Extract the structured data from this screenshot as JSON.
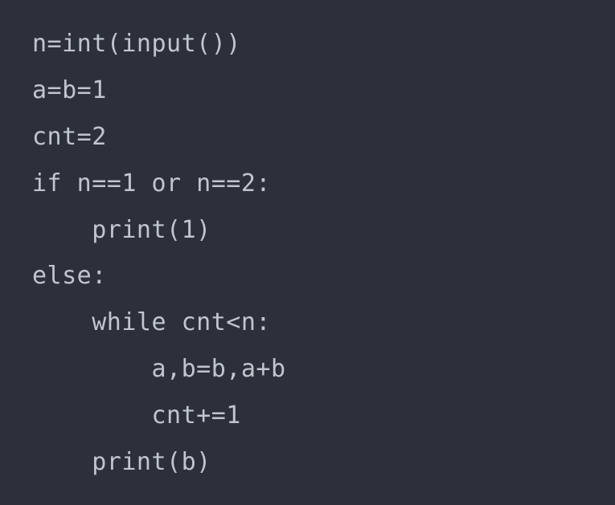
{
  "code": {
    "lines": [
      "n=int(input())",
      "a=b=1",
      "cnt=2",
      "if n==1 or n==2:",
      "    print(1)",
      "else:",
      "    while cnt<n:",
      "        a,b=b,a+b",
      "        cnt+=1",
      "    print(b)"
    ]
  }
}
